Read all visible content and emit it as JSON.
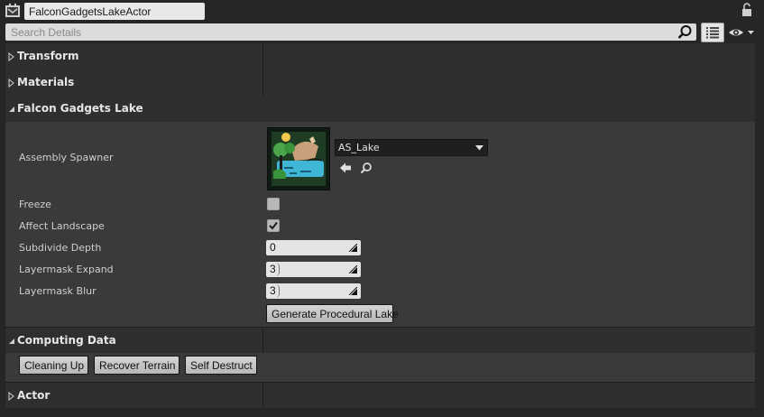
{
  "header": {
    "actor_name": "FalconGadgetsLakeActor"
  },
  "search": {
    "placeholder": "Search Details"
  },
  "categories": {
    "transform": "Transform",
    "materials": "Materials",
    "falcon_gadgets_lake": "Falcon Gadgets Lake",
    "computing_data": "Computing Data",
    "actor": "Actor"
  },
  "lake": {
    "assembly_spawner_label": "Assembly Spawner",
    "assembly_spawner_value": "AS_Lake",
    "freeze_label": "Freeze",
    "freeze_checked": false,
    "affect_landscape_label": "Affect Landscape",
    "affect_landscape_checked": true,
    "subdivide_depth_label": "Subdivide Depth",
    "subdivide_depth_value": "0",
    "layermask_expand_label": "Layermask Expand",
    "layermask_expand_value": "3",
    "layermask_blur_label": "Layermask Blur",
    "layermask_blur_value": "3",
    "generate_button": "Generate Procedural Lake"
  },
  "computing": {
    "cleaning_up": "Cleaning Up",
    "recover_terrain": "Recover Terrain",
    "self_destruct": "Self Destruct"
  },
  "icons": {
    "actor": "actor-icon",
    "lock": "lock-icon",
    "search": "search-icon",
    "view_options": "list-icon",
    "visibility": "eye-icon",
    "use_selected": "arrow-left-icon",
    "browse": "browse-icon"
  },
  "colors": {
    "panel": "#2f2f2f",
    "section_body": "#3a3a3a",
    "field": "#e4e4e4",
    "thumbnail_bg": "#111111",
    "thumbnail_water": "#3fb6d6",
    "thumbnail_green": "#4aa84a"
  }
}
